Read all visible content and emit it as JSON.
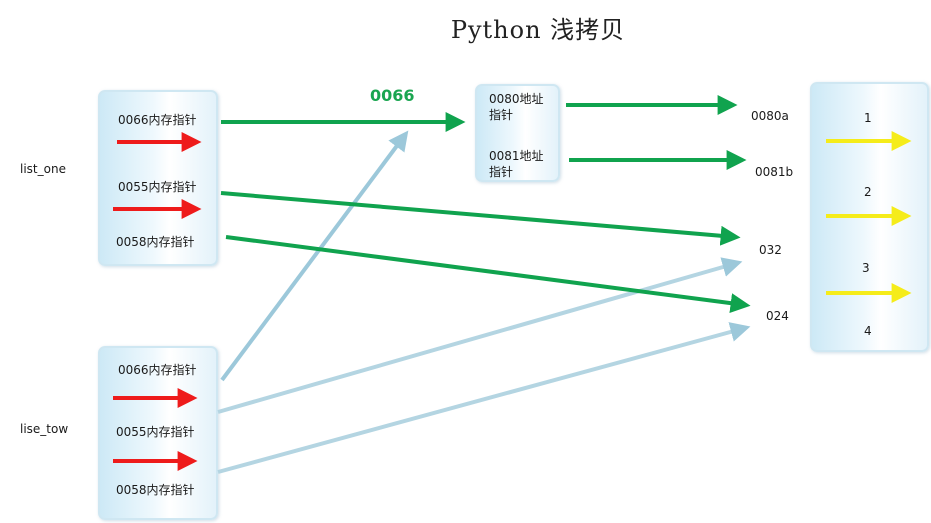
{
  "title": "Python 浅拷贝",
  "list_one": {
    "label": "list_one",
    "items": [
      "0066内存指针",
      "0055内存指针",
      "0058内存指针"
    ]
  },
  "lise_tow": {
    "label": "lise_tow",
    "items": [
      "0066内存指针",
      "0055内存指针",
      "0058内存指针"
    ]
  },
  "highlight_label": "0066",
  "inner_box": {
    "items": [
      "0080地址\n指针",
      "0081地址\n指针"
    ]
  },
  "targets": [
    "0080a",
    "0081b",
    "032",
    "024"
  ],
  "right_box": {
    "items": [
      "1",
      "2",
      "3",
      "4"
    ]
  },
  "colors": {
    "green": "#10a34e",
    "red": "#ee1b1b",
    "light_blue": "#9cc8da",
    "yellow": "#f5ec1a",
    "box_border": "#cfe7f2"
  }
}
